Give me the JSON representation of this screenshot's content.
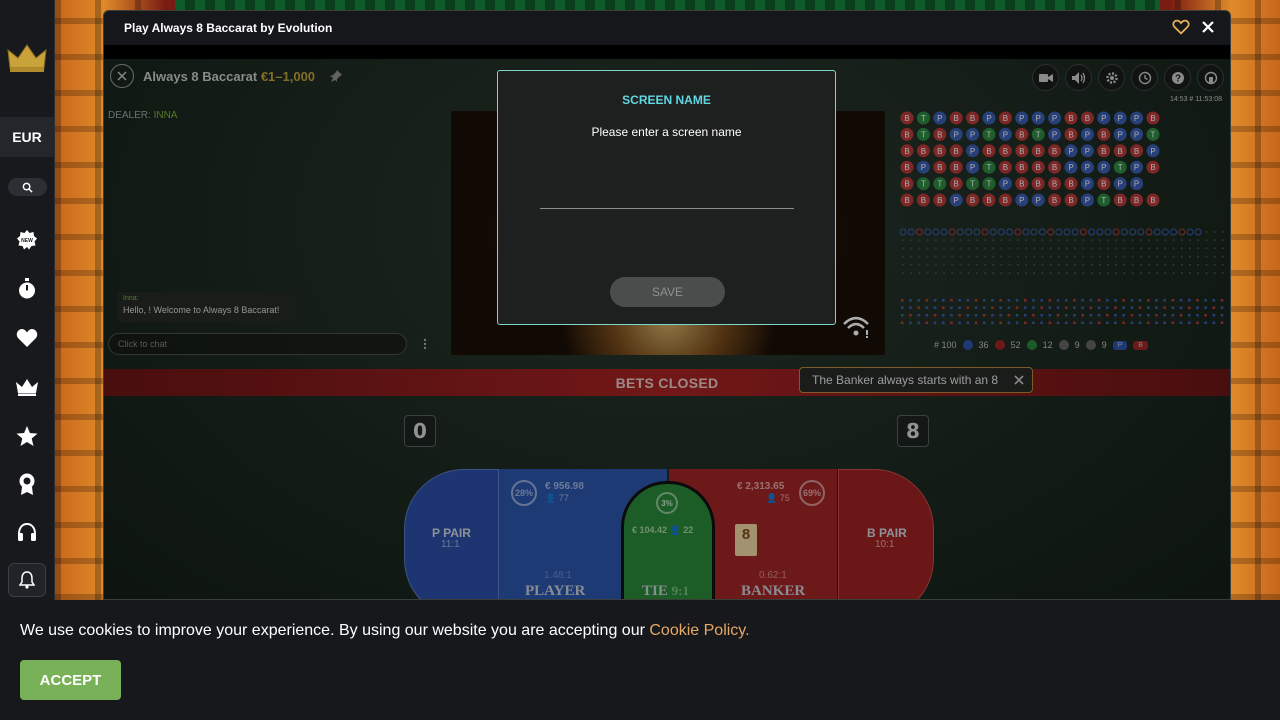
{
  "sidebar": {
    "currency": "EUR"
  },
  "window": {
    "title": "Play Always 8 Baccarat by Evolution"
  },
  "game": {
    "name": "Always 8 Baccarat",
    "limits": "€1–1,000",
    "dealer_label": "DEALER:",
    "dealer_name": "INNA",
    "clock": "14:53  # 11:53:08",
    "chat": {
      "sender": "Inna:",
      "message": "Hello, ! Welcome to Always 8 Baccarat!",
      "input_placeholder": "Click to chat"
    },
    "road_stats": {
      "rounds": "# 100",
      "player": "36",
      "banker": "52",
      "tie": "12",
      "player_pair": "9",
      "banker_pair": "9",
      "player_pred": "P",
      "banker_pred": "B"
    },
    "status": "BETS CLOSED",
    "tooltip": "The Banker always starts with an 8",
    "player_score": "0",
    "banker_score": "8",
    "bets": {
      "player_pair": {
        "label": "P PAIR",
        "odds": "11:1"
      },
      "banker_pair": {
        "label": "B PAIR",
        "odds": "10:1"
      },
      "player": {
        "label": "PLAYER",
        "odds": "1.48:1",
        "pct": "28%",
        "amount": "€ 956.98",
        "players": "77"
      },
      "tie": {
        "label": "TIE",
        "odds": "9:1",
        "pct": "3%",
        "amount": "€ 104.42",
        "players": "22"
      },
      "banker": {
        "label": "BANKER",
        "odds": "0.62:1",
        "pct": "69%",
        "amount": "€ 2,313.65",
        "players": "75"
      },
      "card_value": "8"
    },
    "colors": {
      "player": "#2d56ad",
      "banker": "#a32525",
      "tie": "#2a8a3a",
      "accent": "#62d7e2"
    }
  },
  "modal": {
    "title": "SCREEN NAME",
    "subtitle": "Please enter a screen name",
    "input_value": "",
    "save_label": "SAVE"
  },
  "cookie": {
    "text": "We use cookies to improve your experience. By using our website you are accepting our ",
    "link": "Cookie Policy.",
    "accept_label": "ACCEPT"
  }
}
